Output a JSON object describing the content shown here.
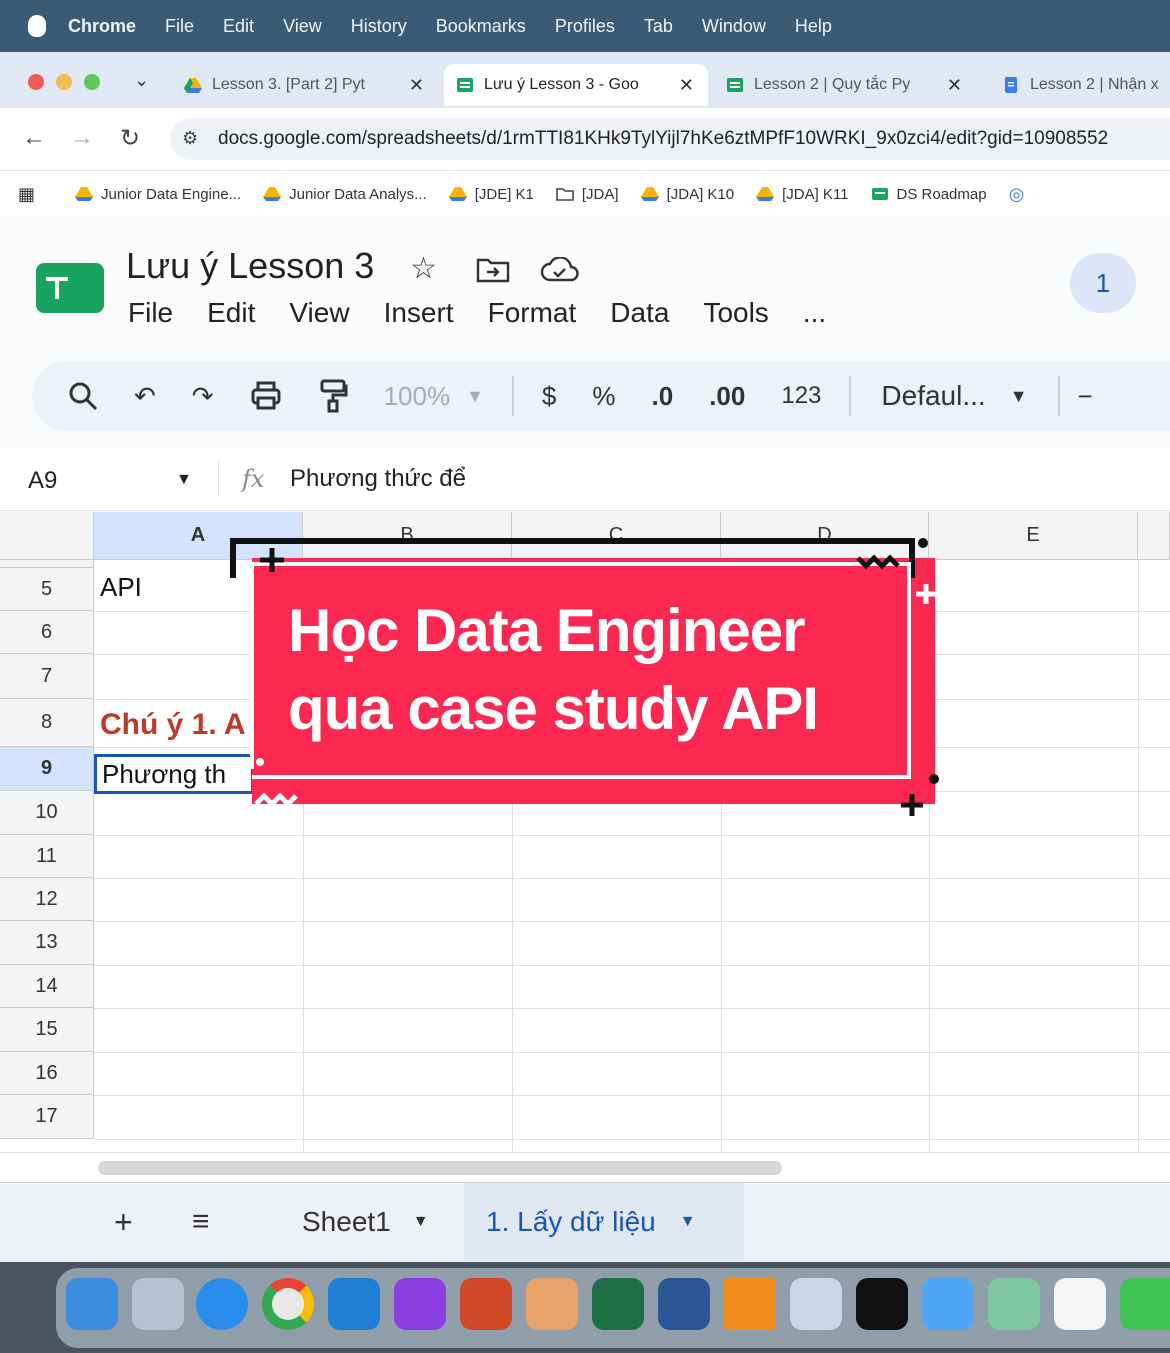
{
  "menubar": {
    "app": "Chrome",
    "items": [
      "File",
      "Edit",
      "View",
      "History",
      "Bookmarks",
      "Profiles",
      "Tab",
      "Window",
      "Help"
    ]
  },
  "tabs": [
    {
      "title": "Lesson 3. [Part 2] Pyt"
    },
    {
      "title": "Lưu ý Lesson 3 - Goo"
    },
    {
      "title": "Lesson 2 | Quy tắc Py"
    },
    {
      "title": "Lesson 2 | Nhận x"
    }
  ],
  "url": "docs.google.com/spreadsheets/d/1rmTTI81KHk9TylYijl7hKe6ztMPfF10WRKI_9x0zci4/edit?gid=10908552",
  "bookmarks": [
    "Junior Data Engine...",
    "Junior Data Analys...",
    "[JDE] K1",
    "[JDA]",
    "[JDA] K10",
    "[JDA] K11",
    "DS Roadmap"
  ],
  "doc": {
    "title": "Lưu ý Lesson 3",
    "menus": [
      "File",
      "Edit",
      "View",
      "Insert",
      "Format",
      "Data",
      "Tools",
      "..."
    ],
    "avatar": "1"
  },
  "toolbar": {
    "zoom": "100%",
    "currency": "$",
    "percent": "%",
    "dec_decrease": ".0",
    "dec_increase": ".00",
    "number_format": "123",
    "font": "Defaul..."
  },
  "formula_bar": {
    "cell_ref": "A9",
    "fx": "fx",
    "content": "Phương thức để"
  },
  "columns": [
    "A",
    "B",
    "C",
    "D",
    "E"
  ],
  "rows": [
    "5",
    "6",
    "7",
    "8",
    "9",
    "10",
    "11",
    "12",
    "13",
    "14",
    "15",
    "16",
    "17"
  ],
  "cells": {
    "a5": "API",
    "a8": "Chú ý 1. A",
    "a9": "Phương th"
  },
  "sheets": [
    "Sheet1",
    "1. Lấy dữ liệu"
  ],
  "overlay": {
    "line1": "Học Data Engineer",
    "line2": "qua case study API"
  },
  "colors": {
    "accent_red": "#fb2852",
    "sheets_green": "#1aa260",
    "active_blue": "#1a56b8"
  }
}
